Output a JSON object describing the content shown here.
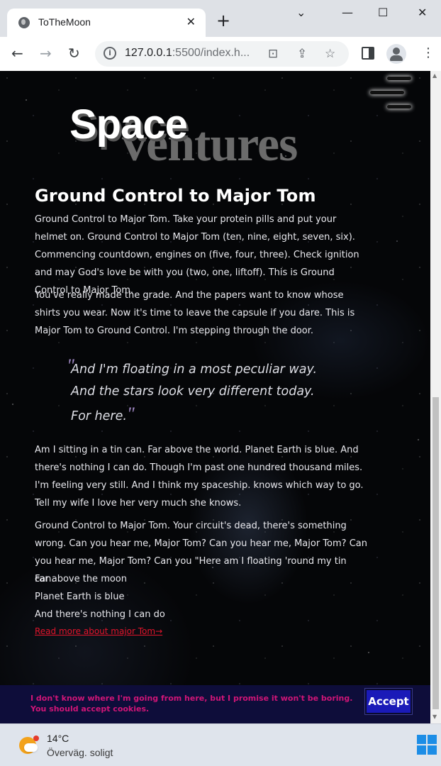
{
  "browser": {
    "tab_title": "ToTheMoon",
    "url_host": "127.0.0.1",
    "url_rest": ":5500/index.h...",
    "icons": [
      "world-icon",
      "close-icon",
      "plus-icon",
      "chevron-down-icon",
      "minimize-icon",
      "maximize-icon",
      "window-close-icon",
      "back-icon",
      "forward-icon",
      "reload-icon",
      "info-icon",
      "translate-icon",
      "share-icon",
      "star-icon",
      "side-panel-icon",
      "profile-icon",
      "kebab-icon"
    ]
  },
  "site": {
    "logo_primary": "Space",
    "logo_secondary": "ventures",
    "heading": "Ground Control to Major Tom",
    "paragraphs": [
      "Ground Control to Major Tom. Take your protein pills and put your helmet on. Ground Control to Major Tom (ten, nine, eight, seven, six). Commencing countdown, engines on (five, four, three). Check ignition and may God's love be with you (two, one, liftoff). This is Ground Control to Major Tom.",
      "You've really made the grade. And the papers want to know whose shirts you wear. Now it's time to leave the capsule if you dare. This is Major Tom to Ground Control. I'm stepping through the door."
    ],
    "quote_lines": [
      "And I'm floating in a most peculiar way.",
      "And the stars look very different today.",
      "For here."
    ],
    "quote_open_mark": "\"",
    "quote_close_mark": "\"",
    "paragraphs_after": [
      "Am I sitting in a tin can. Far above the world. Planet Earth is blue. And there's nothing I can do. Though I'm past one hundred thousand miles. I'm feeling very still. And I think my spaceship. knows which way to go. Tell my wife I love her very much she knows.",
      "Ground Control to Major Tom. Your circuit's dead, there's something wrong. Can you hear me, Major Tom? Can you hear me, Major Tom? Can you hear me, Major Tom? Can you \"Here am I floating 'round my tin can."
    ],
    "lyric_lines": [
      "Far above the moon",
      "Planet Earth is blue",
      "And there's nothing I can do"
    ],
    "read_more": "Read more about major Tom→",
    "colors": {
      "link": "#e2142b",
      "cookie_text": "#d01577",
      "accept_bg": "#1a1ab8",
      "cookie_bg": "#0e0d3a"
    }
  },
  "cookie": {
    "line1": "I don't know where I'm going from here, but I promise it won't be boring.",
    "line2": "You should accept cookies.",
    "accept_label": "Accept"
  },
  "taskbar": {
    "temperature": "14°C",
    "condition": "Överväg. soligt"
  }
}
